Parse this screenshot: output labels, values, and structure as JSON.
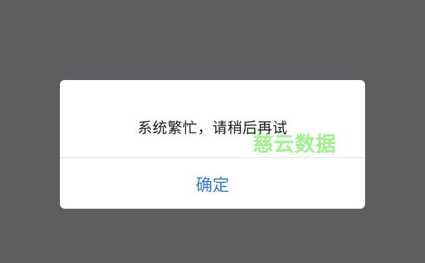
{
  "dialog": {
    "message": "系统繁忙，请稍后再试",
    "confirm_label": "确定"
  },
  "watermark": {
    "text": "慈云数据"
  },
  "colors": {
    "overlay": "#5e5e60",
    "dialog_background": "#ffffff",
    "confirm_text": "#3b7cc4",
    "watermark": "#8df07a"
  }
}
